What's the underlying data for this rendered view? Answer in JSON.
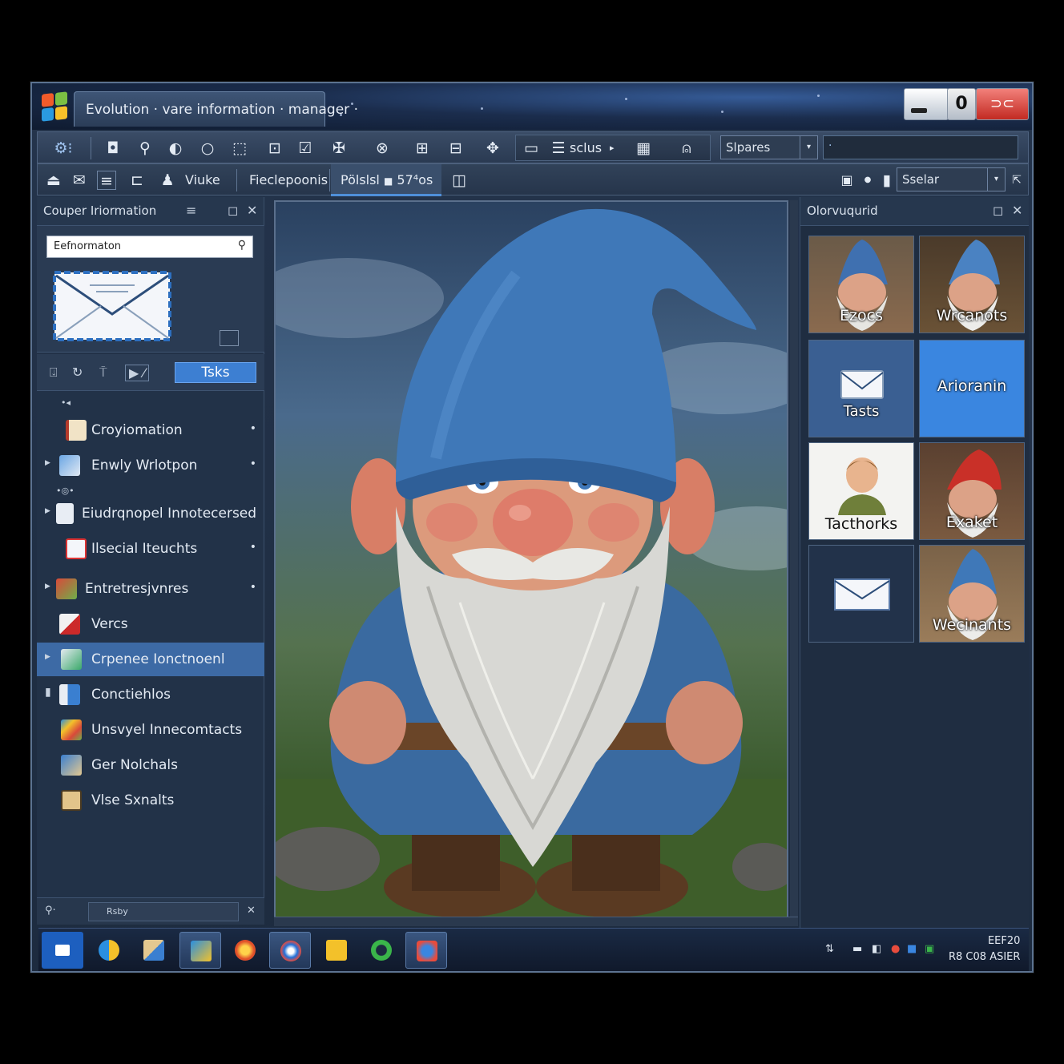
{
  "window": {
    "title": "Evolution · vare information · manager ·",
    "max_label": "0",
    "close_label": "⊃⊂"
  },
  "toolbar1": {
    "view_label": "sclus",
    "spares_combo": "Slpares",
    "search_value": "·"
  },
  "toolbar2": {
    "tabs": [
      "Viuke",
      "Fieclepoonis",
      "Pölslsl"
    ],
    "active_extra": "57⁴os",
    "right_combo": "Sselar"
  },
  "left_panel": {
    "header": "Couper Iriormation",
    "search_value": "Eefnormaton",
    "tasks_button": "Tsks",
    "tree": [
      {
        "label": "Croyiomation"
      },
      {
        "label": "Enwly Wrlotpon"
      },
      {
        "label": "Eiudrqnopel Innotecersed"
      },
      {
        "label": "Ilsecial Iteuchts"
      },
      {
        "label": "Entretresjvnres"
      },
      {
        "label": "Vercs"
      },
      {
        "label": "Crpenee Ionctnoenl"
      },
      {
        "label": "Conctiehlos"
      },
      {
        "label": "Unsvyel Innecomtacts"
      },
      {
        "label": "Ger Nolchals"
      },
      {
        "label": "Vlse Sxnalts"
      }
    ],
    "footer_field": "Rsby"
  },
  "right_panel": {
    "header": "Olorvuqurid",
    "tiles": [
      {
        "caption": "Ezocs"
      },
      {
        "caption": "Wrcanots"
      },
      {
        "caption": "Tasts"
      },
      {
        "caption": "Arioranin"
      },
      {
        "caption": "Tacthorks"
      },
      {
        "caption": "Exaket"
      },
      {
        "caption": ""
      },
      {
        "caption": "Wecinants"
      }
    ]
  },
  "taskbar": {
    "clock_line1": "EEF20",
    "clock_line2": "R8 C08 ASIER"
  },
  "colors": {
    "accent": "#3d7fd2",
    "selection": "#3d6aa5",
    "window_bg": "#24344c",
    "hat_blue": "#3f78b8"
  }
}
